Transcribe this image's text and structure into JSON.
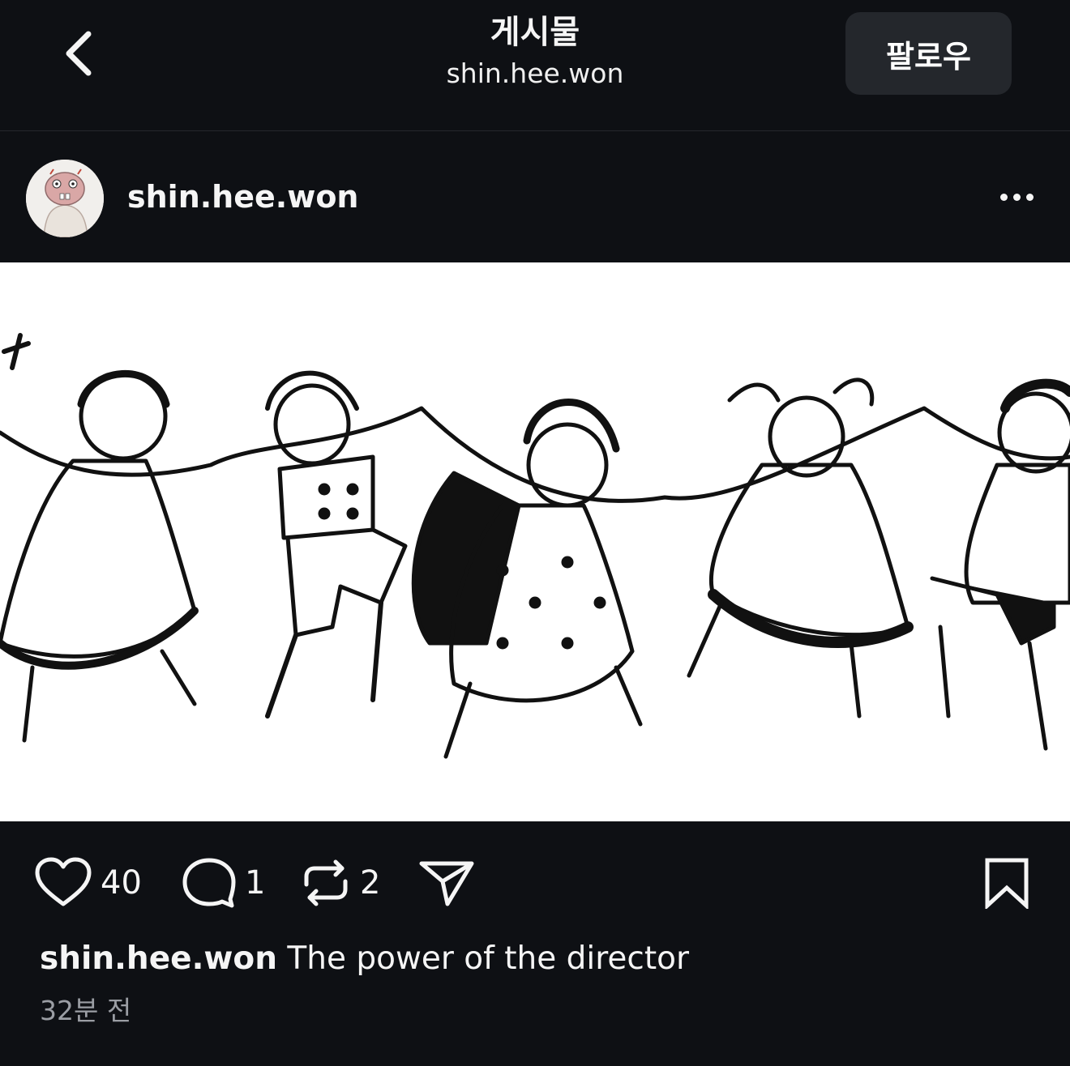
{
  "header": {
    "title": "게시물",
    "subtitle": "shin.hee.won",
    "follow_label": "팔로우"
  },
  "post": {
    "username": "shin.hee.won",
    "media_description_icon": "dancing-children-illustration",
    "likes": "40",
    "comments": "1",
    "reposts": "2",
    "caption_user": "shin.hee.won",
    "caption_text": " The power of the director",
    "time": "32분 전"
  },
  "colors": {
    "background": "#0e1014",
    "button_bg": "#24272c",
    "muted_text": "#9b9ea4"
  }
}
